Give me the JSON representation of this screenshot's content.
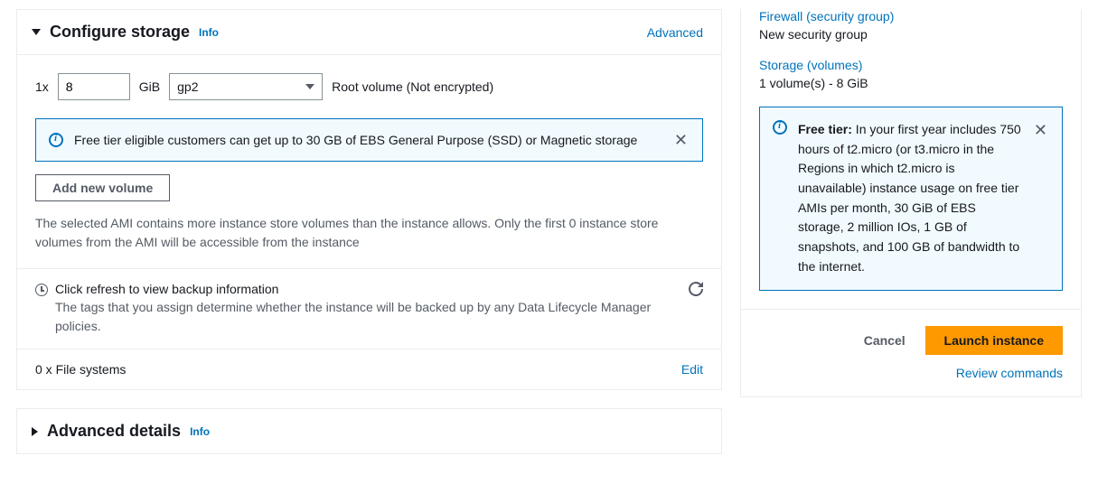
{
  "storage_panel": {
    "title": "Configure storage",
    "info": "Info",
    "advanced": "Advanced",
    "qty_prefix": "1x",
    "size_value": "8",
    "unit": "GiB",
    "volume_type": "gp2",
    "root_desc": "Root volume  (Not encrypted)",
    "alert": "Free tier eligible customers can get up to 30 GB of EBS General Purpose (SSD) or Magnetic storage",
    "add_volume": "Add new volume",
    "ami_note": "The selected AMI contains more instance store volumes than the instance allows. Only the first 0 instance store volumes from the AMI will be accessible from the instance",
    "refresh_line": "Click refresh to view backup information",
    "refresh_note": "The tags that you assign determine whether the instance will be backed up by any Data Lifecycle Manager policies.",
    "file_systems": "0 x File systems",
    "edit": "Edit"
  },
  "advanced_panel": {
    "title": "Advanced details",
    "info": "Info"
  },
  "summary": {
    "firewall_head": "Firewall (security group)",
    "firewall_val": "New security group",
    "storage_head": "Storage (volumes)",
    "storage_val": "1 volume(s) - 8 GiB",
    "free_tier_bold": "Free tier:",
    "free_tier_text": " In your first year includes 750 hours of t2.micro (or t3.micro in the Regions in which t2.micro is unavailable) instance usage on free tier AMIs per month, 30 GiB of EBS storage, 2 million IOs, 1 GB of snapshots, and 100 GB of bandwidth to the internet.",
    "cancel": "Cancel",
    "launch": "Launch instance",
    "review": "Review commands"
  }
}
